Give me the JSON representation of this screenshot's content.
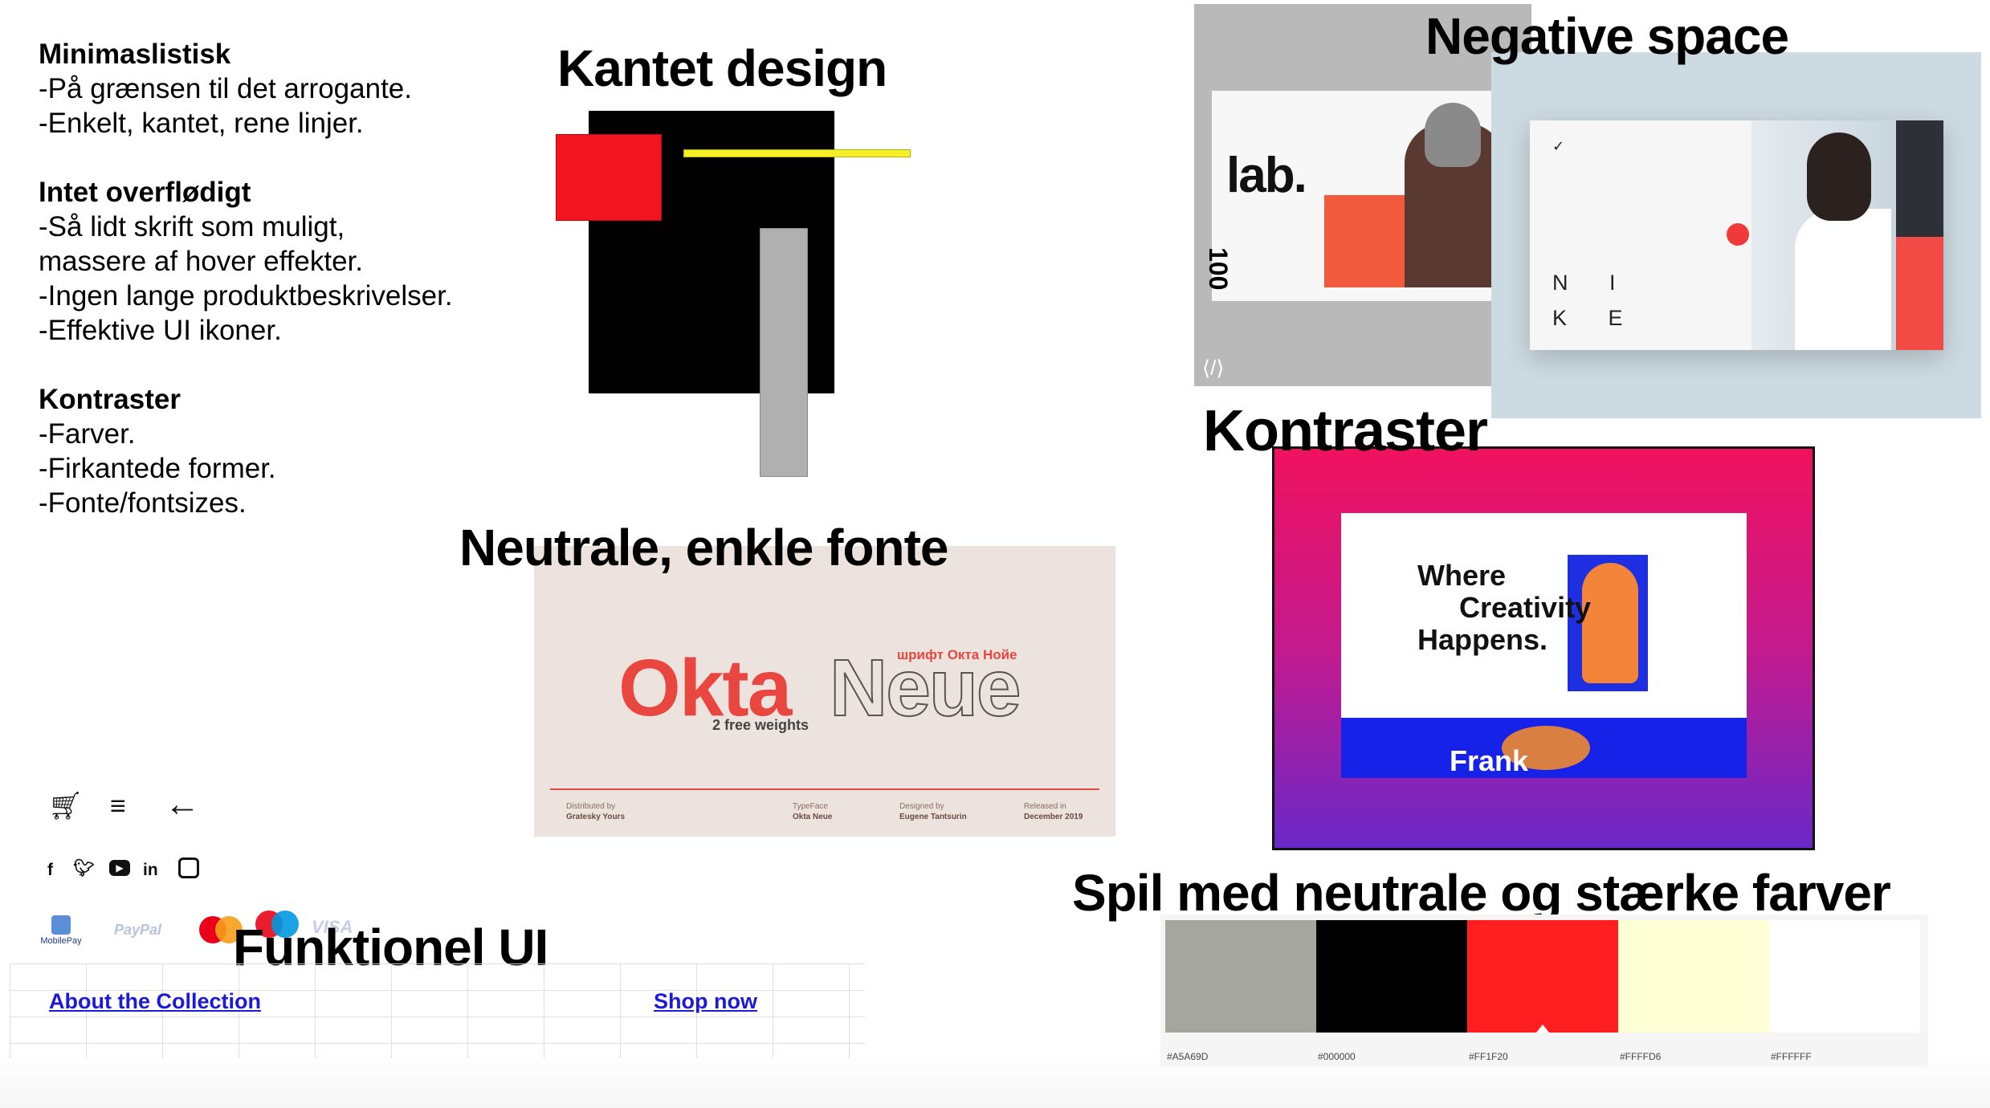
{
  "notes": {
    "sections": [
      {
        "title": "Minimaslistisk",
        "lines": [
          "-På grænsen til det arrogante.",
          "-Enkelt, kantet, rene linjer."
        ]
      },
      {
        "title": "Intet overflødigt",
        "lines": [
          "-Så lidt skrift som muligt,",
          "massere af hover effekter.",
          "-Ingen lange produktbeskrivelser.",
          "-Effektive UI ikoner."
        ]
      },
      {
        "title": "Kontraster",
        "lines": [
          "-Farver.",
          "-Firkantede former.",
          "-Fonte/fontsizes."
        ]
      }
    ]
  },
  "headings": {
    "kantet": "Kantet design",
    "negative": "Negative space",
    "kontraster": "Kontraster",
    "fonte": "Neutrale, enkle fonte",
    "spil": "Spil med neutrale og stærke farver",
    "funktionel": "Funktionel UI"
  },
  "okta": {
    "main": "Okta",
    "neue": "Neue",
    "russian": "шрифт Окта Нойе",
    "sub": "2 free weights",
    "footer": [
      {
        "k": "Distributed by",
        "v": "Gratesky Yours"
      },
      {
        "k": "TypeFace",
        "v": "Okta Neue"
      },
      {
        "k": "Designed by",
        "v": "Eugene Tantsurin"
      },
      {
        "k": "Released in",
        "v": "December 2019"
      }
    ]
  },
  "lab": {
    "word": "lab.",
    "num": "100"
  },
  "nike": {
    "letters_top": "N I",
    "letters_bottom": "K E"
  },
  "frank": {
    "tagline": [
      "Where",
      "Creativity",
      "Happens."
    ],
    "name": "Frank"
  },
  "icons": [
    "cart-icon",
    "menu-icon",
    "arrow-left-icon",
    "facebook-icon",
    "twitter-icon",
    "youtube-icon",
    "linkedin-icon",
    "instagram-icon"
  ],
  "payments": {
    "mobilepay": "MobilePay",
    "paypal": "PayPal",
    "visa": "VISA"
  },
  "links": {
    "about": "About the Collection",
    "shop": "Shop now"
  },
  "palette": [
    {
      "hex": "#A5A69D",
      "label": "#A5A69D"
    },
    {
      "hex": "#000000",
      "label": "#000000"
    },
    {
      "hex": "#FF1F20",
      "label": "#FF1F20"
    },
    {
      "hex": "#FFFFD6",
      "label": "#FFFFD6"
    },
    {
      "hex": "#FFFFFF",
      "label": "#FFFFFF"
    }
  ]
}
